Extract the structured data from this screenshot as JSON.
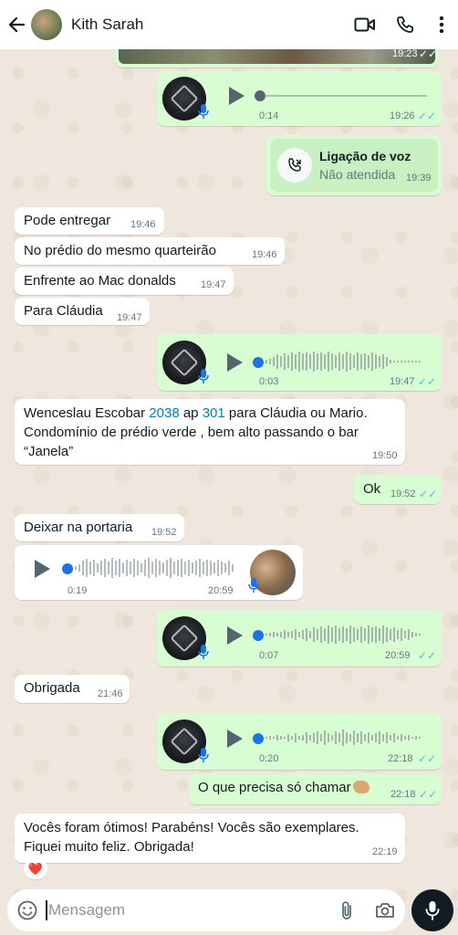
{
  "header": {
    "contact_name": "Kith Sarah"
  },
  "messages": {
    "img_time": "19:23",
    "voice1": {
      "duration": "0:14",
      "time": "19:26"
    },
    "call": {
      "title": "Ligação de voz",
      "status": "Não atendida",
      "time": "19:39"
    },
    "m1": {
      "text": "Pode entregar",
      "time": "19:46"
    },
    "m2": {
      "text": "No prédio  do mesmo quarteirão",
      "time": "19:46"
    },
    "m3": {
      "text": "Enfrente ao Mac donalds",
      "time": "19:47"
    },
    "m4": {
      "text": "Para Cláudia",
      "time": "19:47"
    },
    "voice2": {
      "duration": "0:03",
      "time": "19:47"
    },
    "m5": {
      "pre": "Wenceslau Escobar ",
      "num1": "2038",
      "mid": " ap ",
      "num2": "301",
      "post": " para Cláudia ou Mario.",
      "line2": "Condomínio de prédio verde , bem alto passando o bar",
      "line3": "“Janela”",
      "time": "19:50"
    },
    "m6": {
      "text": "Ok",
      "time": "19:52"
    },
    "m7": {
      "text": "Deixar na portaria",
      "time": "19:52"
    },
    "voice3": {
      "duration": "0:19",
      "time": "20:59"
    },
    "voice4": {
      "duration": "0:07",
      "time": "20:59"
    },
    "m8": {
      "text": "Obrigada",
      "time": "21:46"
    },
    "voice5": {
      "duration": "0:20",
      "time": "22:18"
    },
    "m9": {
      "text": "O que precisa só chamar",
      "time": "22:18"
    },
    "m10": {
      "line1": "Vocês foram ótimos! Parabéns! Vocês são exemplares.",
      "line2": "Fiquei muito feliz. Obrigada!",
      "time": "22:19",
      "reaction": "❤️"
    }
  },
  "input": {
    "placeholder": "Mensagem"
  },
  "colors": {
    "outgoing": "#d9fdd3",
    "incoming": "#ffffff",
    "read_ticks": "#53bdeb",
    "accent_dot": "#1a73e8"
  }
}
